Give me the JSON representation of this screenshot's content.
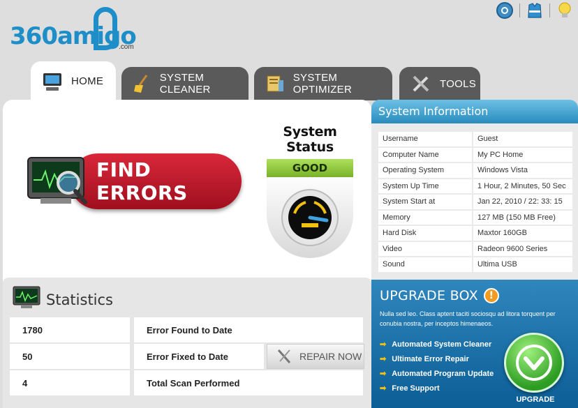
{
  "brand": {
    "logo_text": "360amigo",
    "logo_suffix": ".com"
  },
  "header_icons": [
    "gear-icon",
    "lifevest-icon",
    "lightbulb-icon"
  ],
  "tabs": [
    {
      "label": "HOME",
      "icon": "home-icon",
      "active": true
    },
    {
      "label": "SYSTEM CLEANER",
      "icon": "broom-icon",
      "active": false
    },
    {
      "label": "SYSTEM OPTIMIZER",
      "icon": "optimizer-icon",
      "active": false
    },
    {
      "label": "TOOLS",
      "icon": "tools-icon",
      "active": false
    }
  ],
  "main": {
    "find_errors_label": "FIND ERRORS",
    "status_title": "System Status",
    "status_value": "GOOD"
  },
  "statistics": {
    "title": "Statistics",
    "rows": [
      {
        "value": "1780",
        "label": "Error Found to Date"
      },
      {
        "value": "50",
        "label": "Error Fixed to Date"
      },
      {
        "value": "4",
        "label": "Total Scan Performed"
      }
    ],
    "repair_label": "REPAIR NOW"
  },
  "system_info": {
    "title": "System Information",
    "rows": [
      {
        "key": "Username",
        "value": "Guest"
      },
      {
        "key": "Computer Name",
        "value": "My PC Home"
      },
      {
        "key": "Operating System",
        "value": "Windows Vista"
      },
      {
        "key": "System Up Time",
        "value": "1 Hour, 2 Minutes, 50 Sec"
      },
      {
        "key": "System Start at",
        "value": "Jan 22, 2010 / 22: 33: 15"
      },
      {
        "key": "Memory",
        "value": "127 MB (150 MB Free)"
      },
      {
        "key": "Hard Disk",
        "value": "Maxtor 160GB"
      },
      {
        "key": "Video",
        "value": "Radeon 9600 Series"
      },
      {
        "key": "Sound",
        "value": "Ultima USB"
      }
    ]
  },
  "upgrade_box": {
    "title": "UPGRADE BOX",
    "warn_symbol": "!",
    "description": "Nulla sed leo. Class aptent taciti sociosqu ad litora torquent per conubia nostra, per inceptos himenaeos.",
    "features": [
      "Automated System Cleaner",
      "Ultimate Error Repair",
      "Automated Program Update",
      "Free Support"
    ],
    "button_label": "UPGRADE"
  },
  "colors": {
    "accent_blue": "#2a8bbd",
    "find_red": "#c71c2e",
    "status_green": "#8cc63f",
    "tab_dark": "#5a5a5a",
    "upgrade_green": "#3cb02f"
  }
}
